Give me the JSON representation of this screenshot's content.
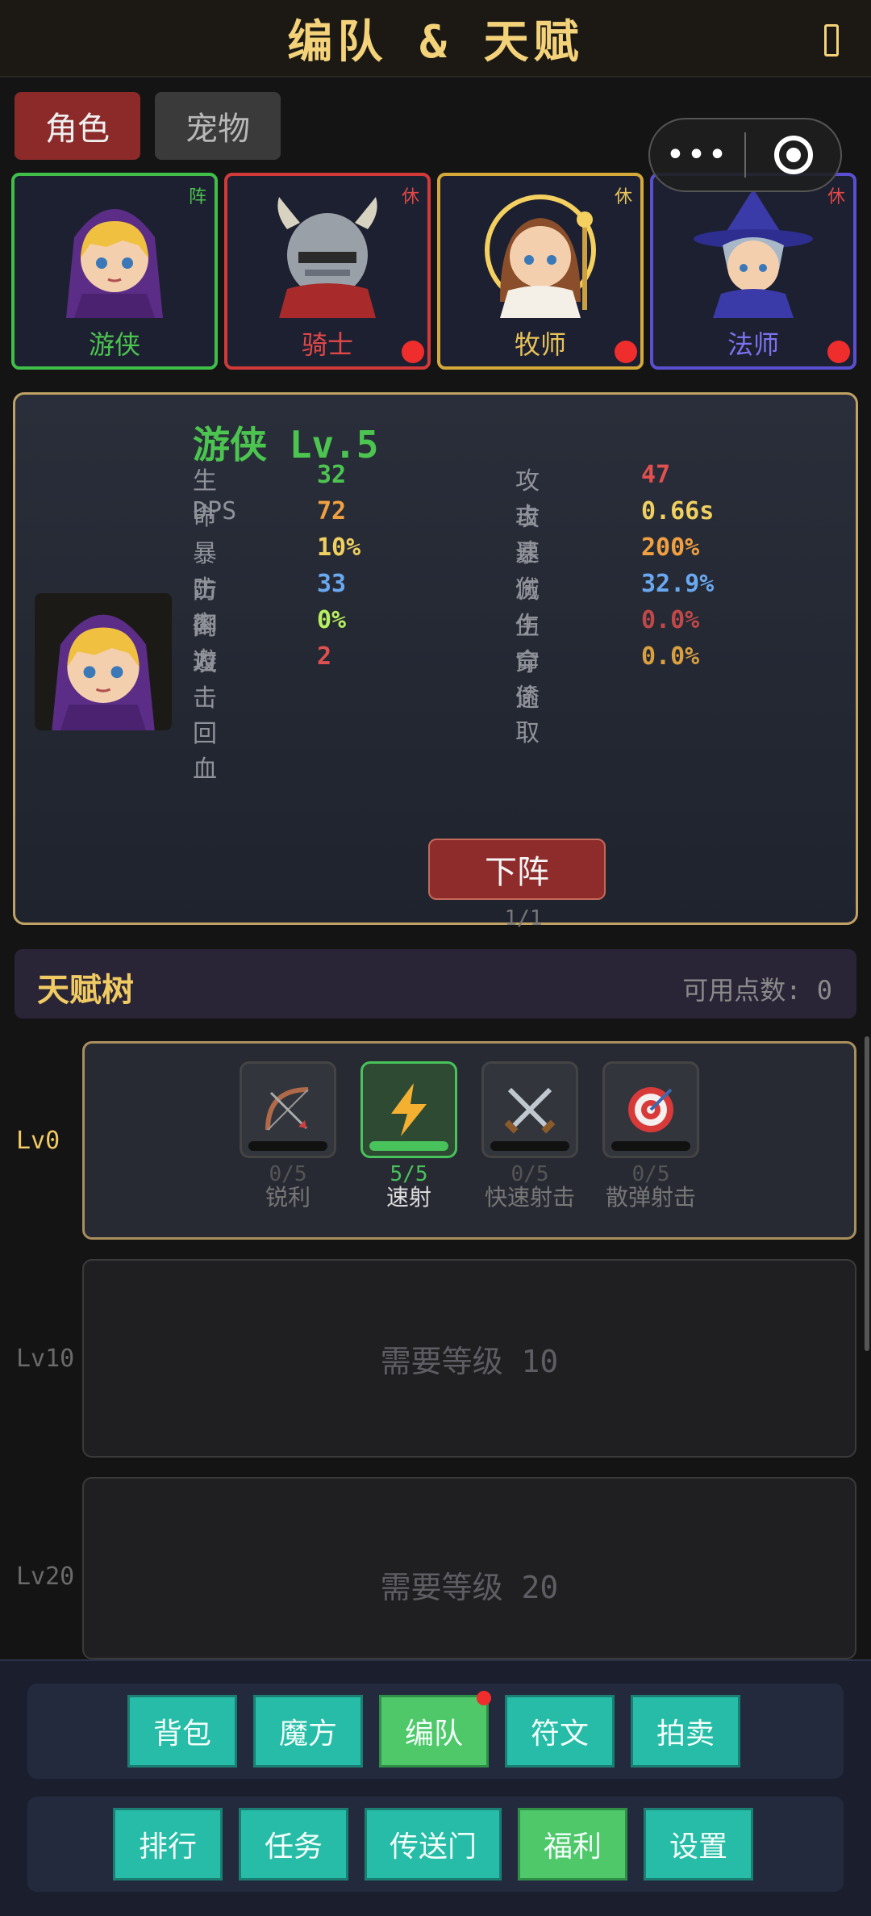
{
  "header": {
    "title": "编队 & 天赋"
  },
  "tabs": [
    {
      "label": "角色",
      "active": true
    },
    {
      "label": "宠物",
      "active": false
    }
  ],
  "heroes": [
    {
      "name": "游侠",
      "tag": "阵",
      "color": "#3fbf4a",
      "name_color": "#4cc450",
      "alert": false
    },
    {
      "name": "骑士",
      "tag": "休",
      "color": "#d23a3a",
      "name_color": "#e04848",
      "alert": true
    },
    {
      "name": "牧师",
      "tag": "休",
      "color": "#d4a93a",
      "name_color": "#e8c35a",
      "alert": true
    },
    {
      "name": "法师",
      "tag": "休",
      "color": "#5a4fd0",
      "name_color": "#7c72f0",
      "alert": true
    }
  ],
  "detail": {
    "title": "游侠 Lv.5",
    "stats_left": [
      {
        "label": "生命",
        "value": "32",
        "color": "#4cc450"
      },
      {
        "label": "DPS",
        "value": "72",
        "color": "#f0a040"
      },
      {
        "label": "暴击率",
        "value": "10%",
        "color": "#f0d060"
      },
      {
        "label": "防御力",
        "value": "33",
        "color": "#6aa8f0"
      },
      {
        "label": "闪避",
        "value": "0%",
        "color": "#b8f060"
      },
      {
        "label": "攻击回血",
        "value": "2",
        "color": "#e05050"
      }
    ],
    "stats_right": [
      {
        "label": "攻击",
        "value": "47",
        "color": "#e05050"
      },
      {
        "label": "攻速",
        "value": "0.66s",
        "color": "#f0d060"
      },
      {
        "label": "暴伤",
        "value": "200%",
        "color": "#f0a040"
      },
      {
        "label": "减伤",
        "value": "32.9%",
        "color": "#6aa8f0"
      },
      {
        "label": "生命偷取",
        "value": "0.0%",
        "color": "#c04848"
      },
      {
        "label": "穿透",
        "value": "0.0%",
        "color": "#d8a040"
      }
    ],
    "withdraw_label": "下阵",
    "pager": "1/1"
  },
  "talent": {
    "title": "天赋树",
    "points_label": "可用点数: 0",
    "tiers": [
      {
        "level": "Lv0",
        "skills": [
          {
            "name": "锐利",
            "progress": "0/5",
            "fill": 0.0,
            "icon": "bow-icon",
            "active": false
          },
          {
            "name": "速射",
            "progress": "5/5",
            "fill": 1.0,
            "icon": "lightning-icon",
            "active": true
          },
          {
            "name": "快速射击",
            "progress": "0/5",
            "fill": 0.0,
            "icon": "crossed-swords-icon",
            "active": false
          },
          {
            "name": "散弹射击",
            "progress": "0/5",
            "fill": 0.0,
            "icon": "target-icon",
            "active": false
          }
        ]
      },
      {
        "level": "Lv10",
        "locked_text": "需要等级 10"
      },
      {
        "level": "Lv20",
        "locked_text": "需要等级 20"
      }
    ]
  },
  "bottom_nav": {
    "row1": [
      {
        "label": "背包"
      },
      {
        "label": "魔方"
      },
      {
        "label": "编队",
        "highlight": true,
        "badge": true
      },
      {
        "label": "符文"
      },
      {
        "label": "拍卖"
      }
    ],
    "row2": [
      {
        "label": "排行"
      },
      {
        "label": "任务"
      },
      {
        "label": "传送门"
      },
      {
        "label": "福利",
        "highlight": true
      },
      {
        "label": "设置"
      }
    ]
  }
}
